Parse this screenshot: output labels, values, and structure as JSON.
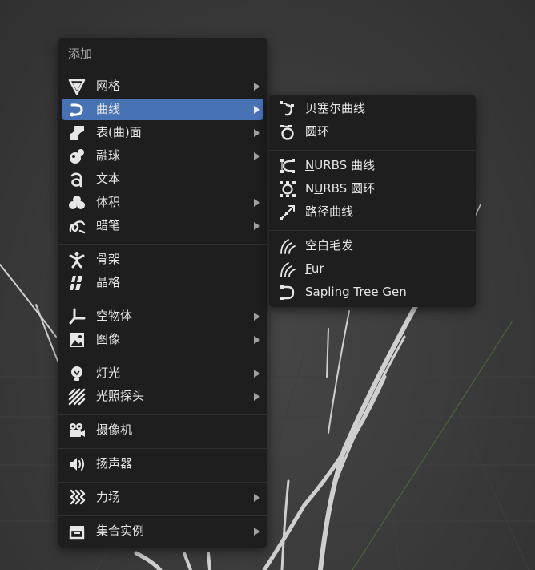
{
  "add_menu": {
    "title": "添加",
    "items": [
      {
        "label": "网格",
        "icon": "mesh-icon",
        "submenu": true
      },
      {
        "label": "曲线",
        "icon": "curve-icon",
        "submenu": true,
        "active": true
      },
      {
        "label": "表(曲)面",
        "icon": "surface-icon",
        "submenu": true
      },
      {
        "label": "融球",
        "icon": "metaball-icon",
        "submenu": true
      },
      {
        "label": "文本",
        "icon": "text-icon",
        "submenu": false
      },
      {
        "label": "体积",
        "icon": "volume-icon",
        "submenu": true
      },
      {
        "label": "蜡笔",
        "icon": "grease-pencil-icon",
        "submenu": true
      },
      {
        "label": "骨架",
        "icon": "armature-icon",
        "submenu": false
      },
      {
        "label": "晶格",
        "icon": "lattice-icon",
        "submenu": false
      },
      {
        "label": "空物体",
        "icon": "empty-icon",
        "submenu": true
      },
      {
        "label": "图像",
        "icon": "image-icon",
        "submenu": true
      },
      {
        "label": "灯光",
        "icon": "light-icon",
        "submenu": true
      },
      {
        "label": "光照探头",
        "icon": "light-probe-icon",
        "submenu": true
      },
      {
        "label": "摄像机",
        "icon": "camera-icon",
        "submenu": false
      },
      {
        "label": "扬声器",
        "icon": "speaker-icon",
        "submenu": false
      },
      {
        "label": "力场",
        "icon": "force-field-icon",
        "submenu": true
      },
      {
        "label": "集合实例",
        "icon": "collection-instance-icon",
        "submenu": true
      }
    ]
  },
  "curve_submenu": {
    "items": [
      {
        "label": "贝塞尔曲线",
        "icon": "bezier-curve-icon"
      },
      {
        "label": "圆环",
        "icon": "bezier-circle-icon"
      },
      {
        "label_ul": "N",
        "label_rest": "URBS 曲线",
        "icon": "nurbs-curve-icon"
      },
      {
        "label_pre": "N",
        "label_ul": "U",
        "label_rest": "RBS 圆环",
        "icon": "nurbs-circle-icon"
      },
      {
        "label": "路径曲线",
        "icon": "path-curve-icon"
      },
      {
        "label": "空白毛发",
        "icon": "hair-icon"
      },
      {
        "label_ul": "F",
        "label_rest": "ur",
        "icon": "fur-icon"
      },
      {
        "label_ul": "S",
        "label_rest": "apling Tree Gen",
        "icon": "sapling-icon"
      }
    ]
  },
  "colors": {
    "menu_bg": "#1e1e1e",
    "highlight": "#4772b3",
    "text": "#e6e6e6",
    "title_text": "#a7a7a7"
  }
}
